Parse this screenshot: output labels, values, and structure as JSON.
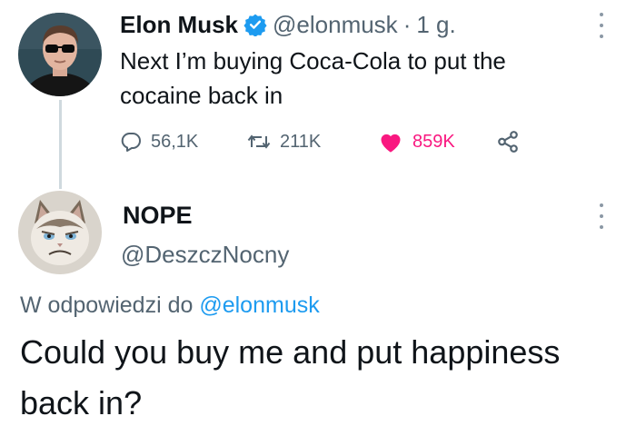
{
  "tweet": {
    "author_name": "Elon Musk",
    "author_handle": "@elonmusk",
    "separator": "·",
    "time": "1 g.",
    "text": "Next I’m buying Coca-Cola to put the cocaine back in",
    "replies": "56,1K",
    "retweets": "211K",
    "likes": "859K",
    "liked": true
  },
  "reply": {
    "author_name": "NOPE",
    "author_handle": "@DeszczNocny",
    "reply_prefix": "W odpowiedzi do",
    "reply_to_handle": "@elonmusk",
    "text": "Could you buy me and put happiness back in?"
  },
  "colors": {
    "verified_badge": "#1d9bf0",
    "like": "#f91880",
    "link": "#1d9bf0",
    "secondary_text": "#536471",
    "thread_line": "#cfd9de"
  },
  "icons": [
    "verified-badge-icon",
    "more-icon",
    "reply-icon",
    "retweet-icon",
    "heart-icon",
    "share-icon"
  ]
}
